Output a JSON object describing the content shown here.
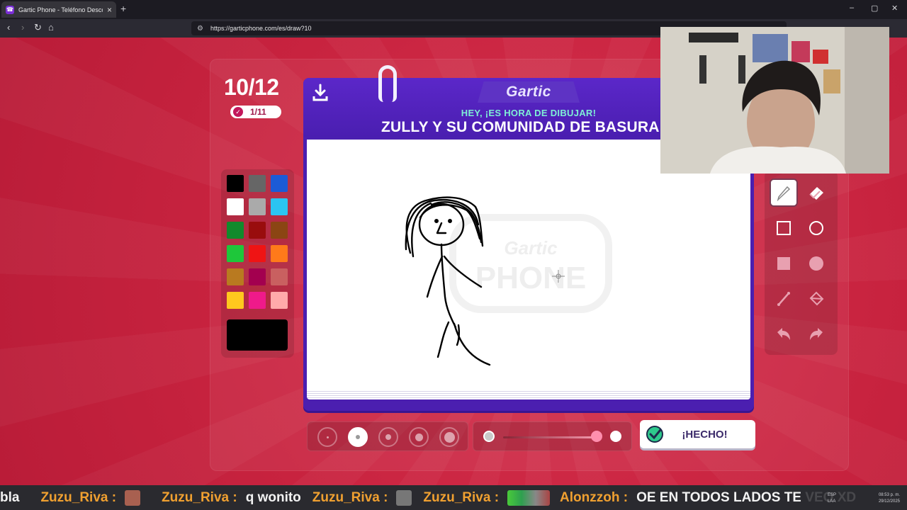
{
  "browser": {
    "tab_title": "Gartic Phone - Teléfono Descom",
    "new_tab": "+",
    "close_tab": "×",
    "url": "https://garticphone.com/es/draw?10",
    "window_controls": {
      "minimize": "–",
      "maximize": "▢",
      "close": "✕"
    }
  },
  "game": {
    "round": "10/12",
    "done_count": "1/11",
    "logo": "Gartic",
    "prompt_label": "HEY, ¡ES HORA DE DIBUJAR!",
    "prompt": "ZULLY Y SU COMUNIDAD DE BASURA",
    "done_button": "¡HECHO!",
    "selected_color": "#000000",
    "selected_tool": "pencil",
    "selected_brush_size": 2,
    "opacity": 1
  },
  "palette": [
    "#000000",
    "#666666",
    "#1c5bd6",
    "#ffffff",
    "#aaaaaa",
    "#2bc4f2",
    "#128a2c",
    "#990d0d",
    "#8b4513",
    "#1ec73a",
    "#ef1414",
    "#ff7a1a",
    "#b97a20",
    "#a3004f",
    "#c96060",
    "#ffc81e",
    "#ef1a8a",
    "#ffaaaa"
  ],
  "tools": [
    "pencil-icon",
    "eraser-icon",
    "rectangle-outline-icon",
    "circle-outline-icon",
    "rectangle-fill-icon",
    "circle-fill-icon",
    "line-icon",
    "bucket-icon",
    "undo-icon",
    "redo-icon"
  ],
  "chat": [
    {
      "name": "bla",
      "msg": ""
    },
    {
      "name": "Zuzu_Riva :",
      "msg": ""
    },
    {
      "name": "Zuzu_Riva :",
      "msg": "q wonito"
    },
    {
      "name": "Zuzu_Riva :",
      "msg": ""
    },
    {
      "name": "Zuzu_Riva :",
      "msg": ""
    },
    {
      "name": "Alonzzoh :",
      "msg": "OE EN TODOS LADOS TE VEO XD"
    }
  ],
  "tray": {
    "lang": "ESP",
    "region": "LAA",
    "time": "08:53 p. m.",
    "date": "29/12/2025"
  }
}
